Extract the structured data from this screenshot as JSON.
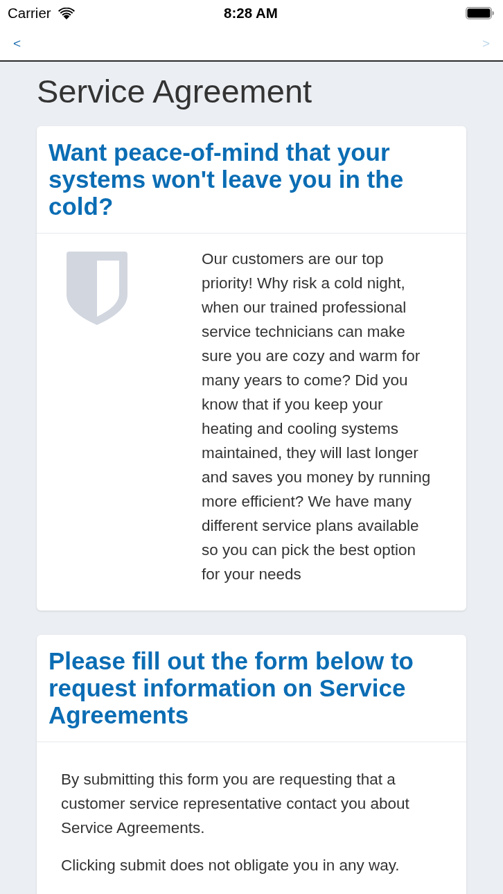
{
  "status_bar": {
    "carrier": "Carrier",
    "time": "8:28 AM"
  },
  "nav_bar": {
    "back": {
      "label": "<",
      "disabled": false
    },
    "forward": {
      "label": ">",
      "disabled": true
    }
  },
  "page_title": "Service Agreement",
  "cards": [
    {
      "kind": "icon_text",
      "heading": "Want peace-of-mind that your systems won't leave you in the cold?",
      "paragraphs": [
        "Our customers are our top priority! Why risk a cold night, when our trained professional service technicians can make sure you are cozy and warm for many years to come? Did you know that if you keep your heating and cooling systems maintained, they will last longer and saves you money by running more efficient? We have many different service plans available so you can pick the best option for your needs"
      ]
    },
    {
      "kind": "text",
      "heading": "Please fill out the form below to request information on Service Agreements",
      "paragraphs": [
        "By submitting this form you are requesting that a customer service representative contact you about Service Agreements.",
        "Clicking submit does not obligate you in any way."
      ]
    }
  ]
}
